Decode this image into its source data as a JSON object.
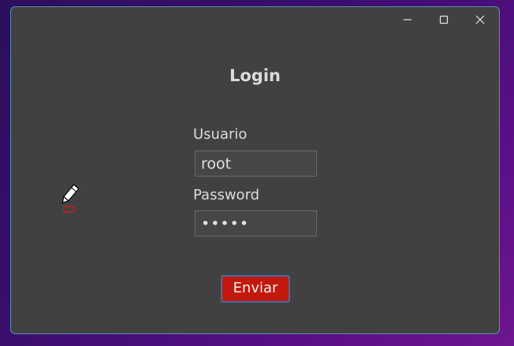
{
  "window": {
    "controls": [
      "minimize-icon",
      "maximize-icon",
      "close-icon"
    ]
  },
  "login": {
    "title": "Login",
    "username_label": "Usuario",
    "username_value": "root",
    "password_label": "Password",
    "password_value": "•••••",
    "submit_label": "Enviar"
  },
  "colors": {
    "window_bg": "#414141",
    "button_bg": "#c2190c",
    "button_border": "#3c6fa8"
  }
}
